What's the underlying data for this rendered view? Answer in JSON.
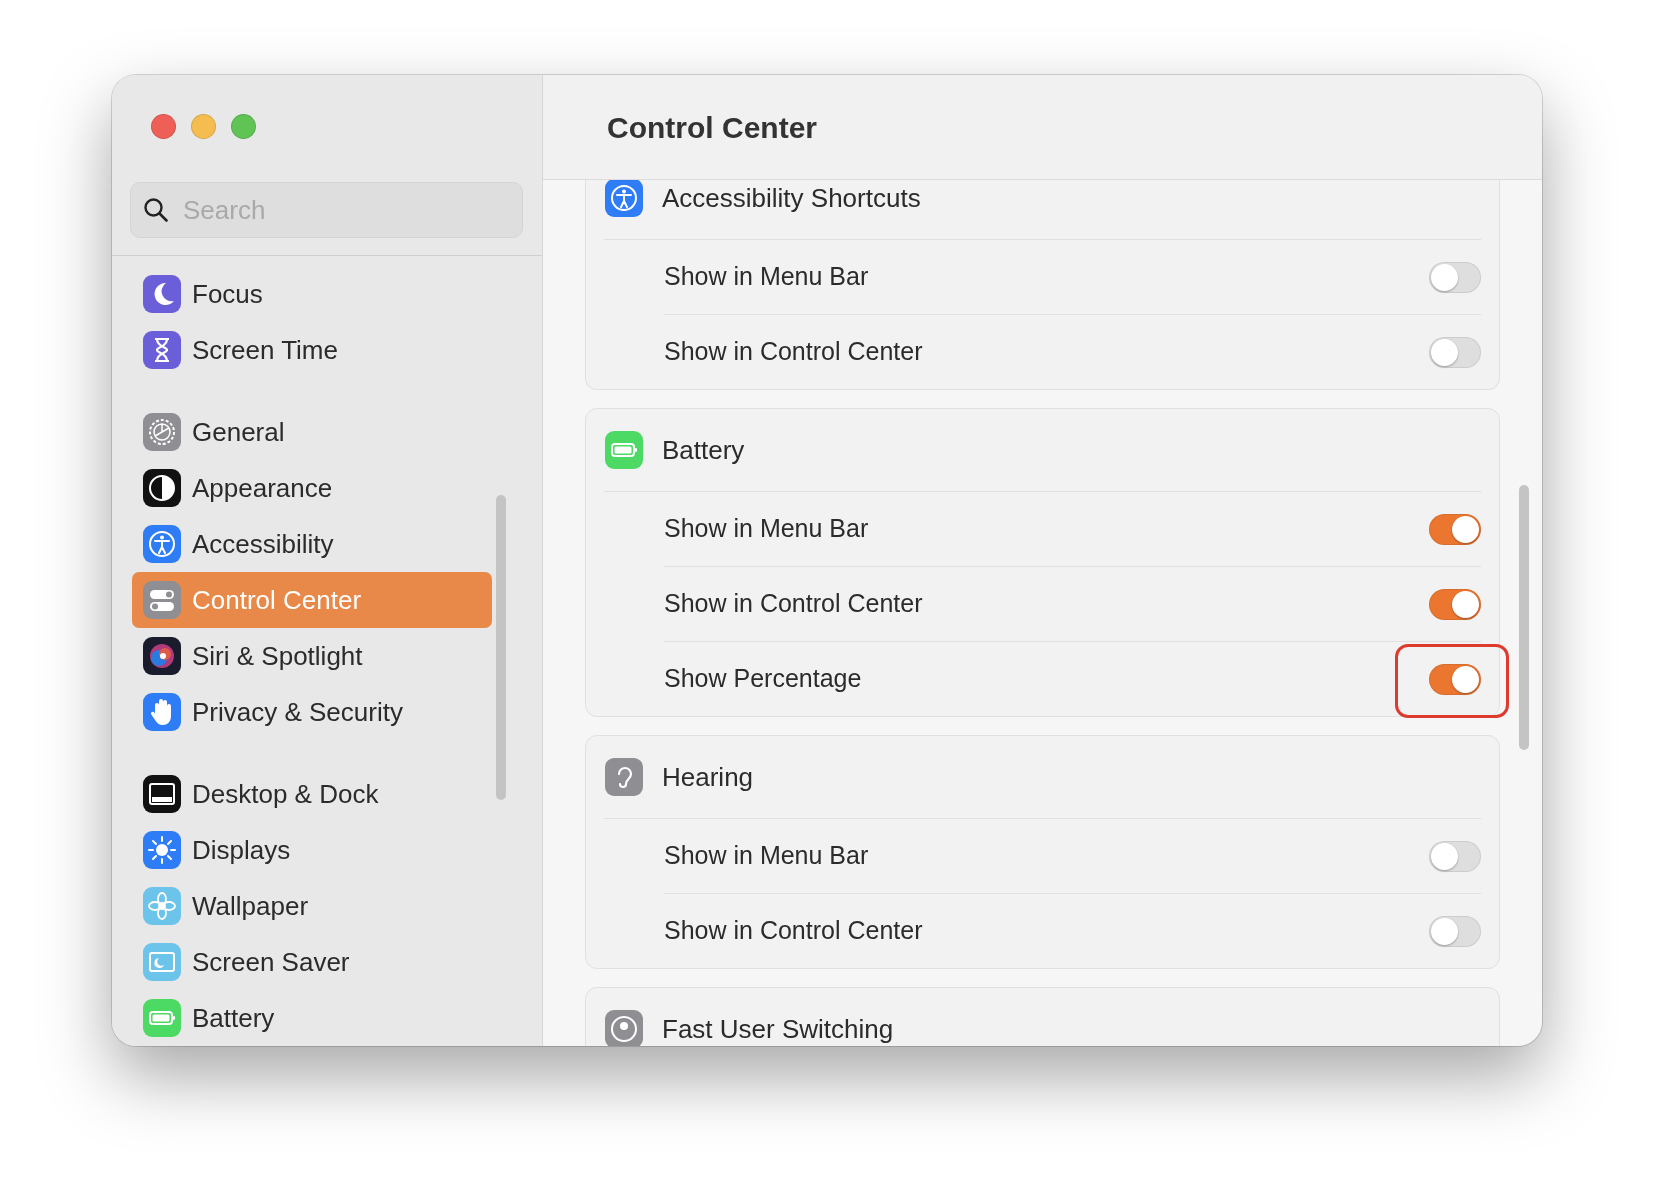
{
  "window": {
    "title": "Control Center"
  },
  "sidebar": {
    "search": {
      "placeholder": "Search"
    },
    "groups": [
      {
        "items": [
          {
            "label": "Focus",
            "selected": false
          },
          {
            "label": "Screen Time",
            "selected": false
          }
        ]
      },
      {
        "items": [
          {
            "label": "General",
            "selected": false
          },
          {
            "label": "Appearance",
            "selected": false
          },
          {
            "label": "Accessibility",
            "selected": false
          },
          {
            "label": "Control Center",
            "selected": true
          },
          {
            "label": "Siri & Spotlight",
            "selected": false
          },
          {
            "label": "Privacy & Security",
            "selected": false
          }
        ]
      },
      {
        "items": [
          {
            "label": "Desktop & Dock",
            "selected": false
          },
          {
            "label": "Displays",
            "selected": false
          },
          {
            "label": "Wallpaper",
            "selected": false
          },
          {
            "label": "Screen Saver",
            "selected": false
          },
          {
            "label": "Battery",
            "selected": false
          }
        ]
      }
    ]
  },
  "sections": [
    {
      "title": "Accessibility Shortcuts",
      "rows": [
        {
          "label": "Show in Menu Bar",
          "on": false,
          "highlighted": false
        },
        {
          "label": "Show in Control Center",
          "on": false,
          "highlighted": false
        }
      ]
    },
    {
      "title": "Battery",
      "rows": [
        {
          "label": "Show in Menu Bar",
          "on": true,
          "highlighted": false
        },
        {
          "label": "Show in Control Center",
          "on": true,
          "highlighted": false
        },
        {
          "label": "Show Percentage",
          "on": true,
          "highlighted": true
        }
      ]
    },
    {
      "title": "Hearing",
      "rows": [
        {
          "label": "Show in Menu Bar",
          "on": false,
          "highlighted": false
        },
        {
          "label": "Show in Control Center",
          "on": false,
          "highlighted": false
        }
      ]
    },
    {
      "title": "Fast User Switching"
    }
  ]
}
